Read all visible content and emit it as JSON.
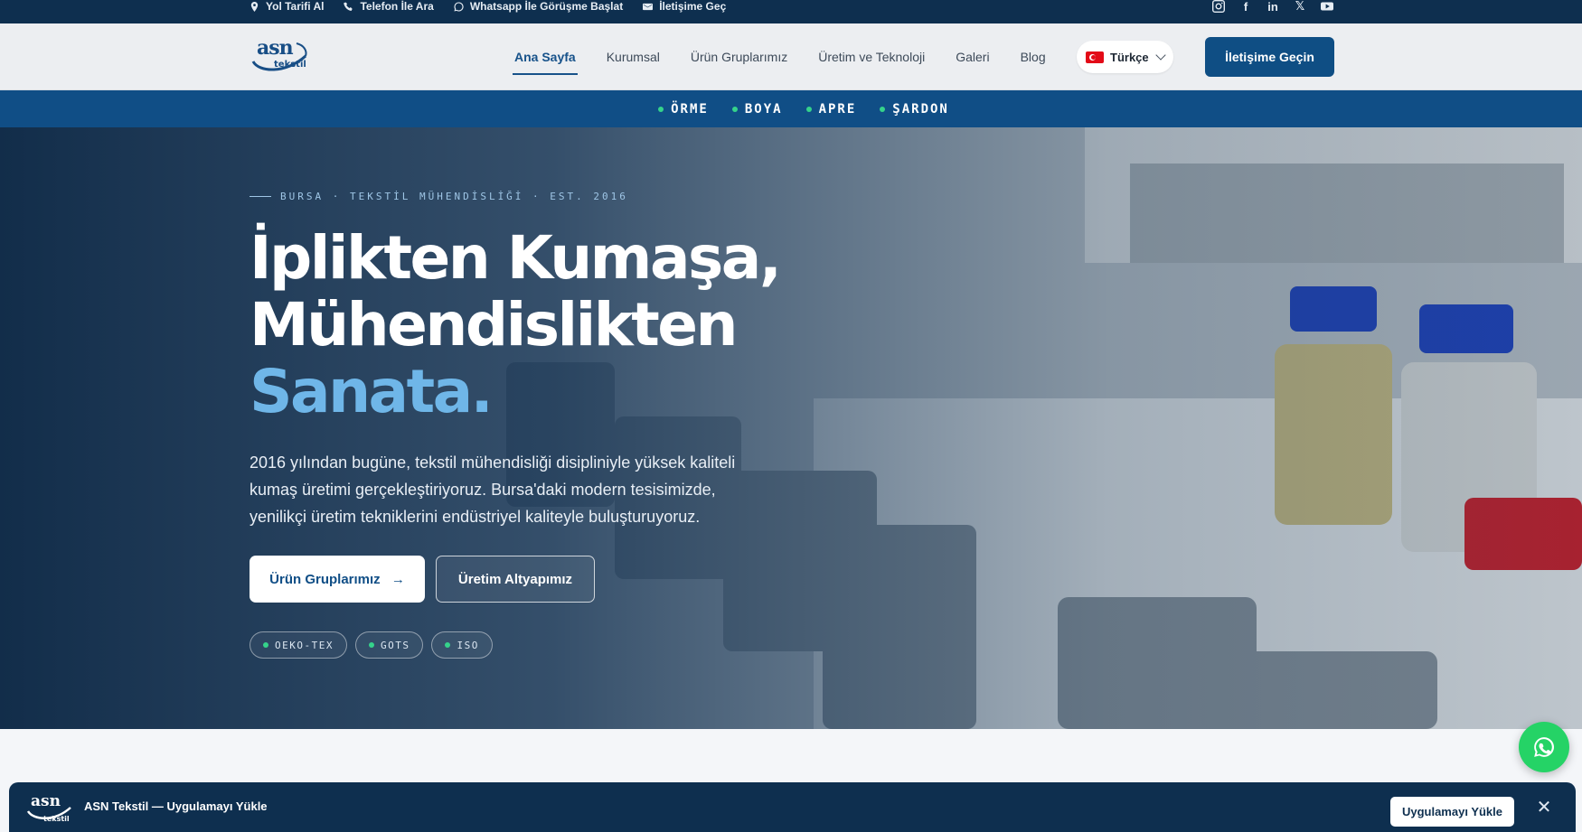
{
  "topbar": {
    "links": [
      {
        "label": "Yol Tarifi Al",
        "icon": "location-pin-icon"
      },
      {
        "label": "Telefon İle Ara",
        "icon": "phone-icon"
      },
      {
        "label": "Whatsapp İle Görüşme Başlat",
        "icon": "whatsapp-icon"
      },
      {
        "label": "İletişime Geç",
        "icon": "mail-icon"
      }
    ],
    "social": [
      "instagram-icon",
      "facebook-icon",
      "linkedin-icon",
      "x-icon",
      "youtube-icon"
    ]
  },
  "header": {
    "logo_text": "asn",
    "logo_subtext": "tekstil",
    "nav": [
      "Ana Sayfa",
      "Kurumsal",
      "Ürün Gruplarımız",
      "Üretim ve Teknoloji",
      "Galeri",
      "Blog"
    ],
    "active_nav": "Ana Sayfa",
    "language": "Türkçe",
    "cta": "İletişime Geçin"
  },
  "categories": [
    "ÖRME",
    "BOYA",
    "APRE",
    "ŞARDON"
  ],
  "hero": {
    "eyebrow": "BURSA · TEKSTİL MÜHENDİSLİĞİ · EST. 2016",
    "title_line1": "İplikten Kumaşa,",
    "title_line2": "Mühendislikten",
    "title_accent": "Sanata.",
    "description": "2016 yılından bugüne, tekstil mühendisliği disipliniyle yüksek kaliteli kumaş üretimi gerçekleştiriyoruz. Bursa'daki modern tesisimizde, yenilikçi üretim tekniklerini endüstriyel kaliteyle buluşturuyoruz.",
    "primary_button": "Ürün Gruplarımız",
    "primary_arrow": "→",
    "secondary_button": "Üretim Altyapımız",
    "badges": [
      "OEKO-TEX",
      "GOTS",
      "ISO"
    ]
  },
  "install_banner": {
    "title": "ASN Tekstil — Uygulamayı Yükle",
    "button": "Uygulamayı Yükle",
    "close": "✕"
  },
  "colors": {
    "primary": "#104e86",
    "dark": "#0e2f4f",
    "accent": "#6fb6e8",
    "badge_dot": "#35d38b",
    "whatsapp": "#25d366"
  }
}
